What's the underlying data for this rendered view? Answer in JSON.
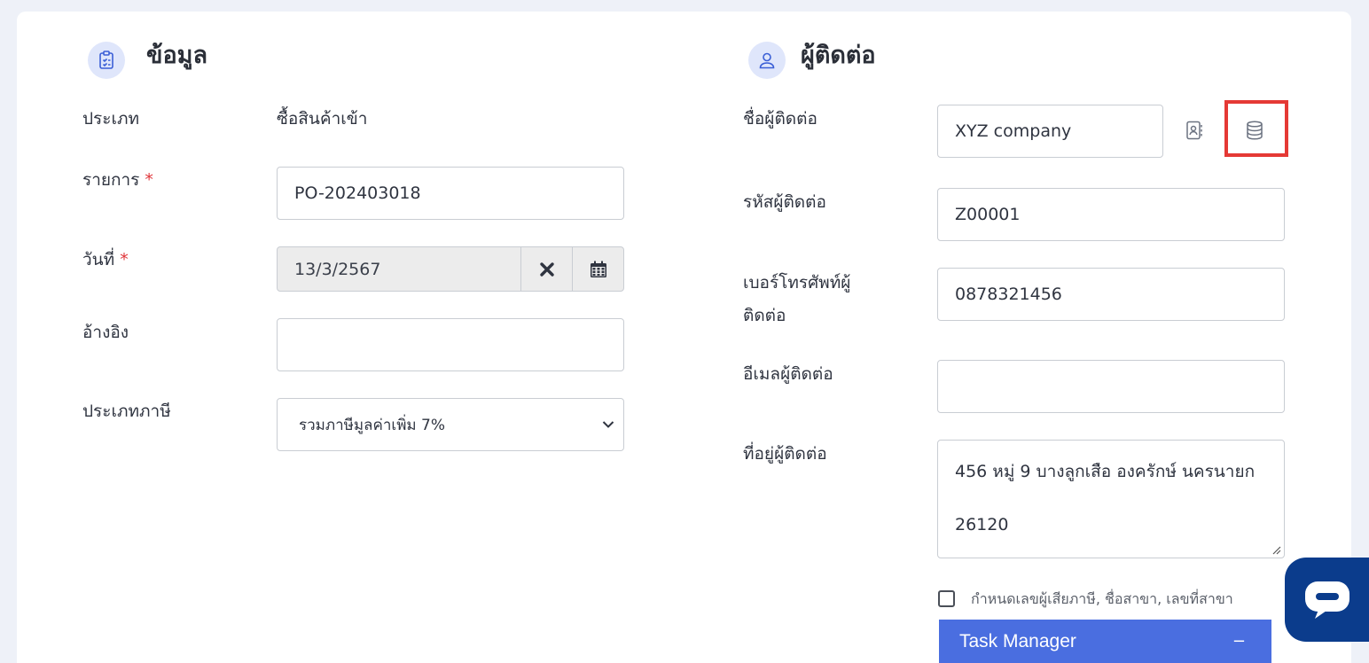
{
  "left_section": {
    "title": "ข้อมูล",
    "type_label": "ประเภท",
    "type_value": "ซื้อสินค้าเข้า",
    "item_label": "รายการ",
    "item_value": "PO-202403018",
    "date_label": "วันที่",
    "date_value": "13/3/2567",
    "ref_label": "อ้างอิง",
    "ref_value": "",
    "tax_label": "ประเภทภาษี",
    "tax_value": "รวมภาษีมูลค่าเพิ่ม 7%",
    "required_mark": "*"
  },
  "right_section": {
    "title": "ผู้ติดต่อ",
    "name_label": "ชื่อผู้ติดต่อ",
    "name_value": "XYZ company",
    "code_label": "รหัสผู้ติดต่อ",
    "code_value": "Z00001",
    "phone_label_line1": "เบอร์โทรศัพท์ผู้",
    "phone_label_line2": "ติดต่อ",
    "phone_value": "0878321456",
    "email_label": "อีเมลผู้ติดต่อ",
    "email_value": "",
    "address_label": "ที่อยู่ผู้ติดต่อ",
    "address_line1": "456 หมู่ 9 บางลูกเสือ องครักษ์ นครนายก",
    "address_line2": "26120",
    "tax_checkbox_label": "กำหนดเลขผู้เสียภาษี, ชื่อสาขา, เลขที่สาขา",
    "tax_checkbox_checked": false
  },
  "task_manager": {
    "title": "Task Manager",
    "minimize": "−"
  },
  "colors": {
    "accent": "#4a6ee0",
    "highlight": "#e53935",
    "chat": "#0b3c8c",
    "icon_bg": "#dfe6fb"
  },
  "icons": [
    "clipboard-icon",
    "user-icon",
    "contact-book-icon",
    "database-icon",
    "clear-icon",
    "calendar-icon",
    "chevron-down-icon",
    "chat-icon"
  ]
}
